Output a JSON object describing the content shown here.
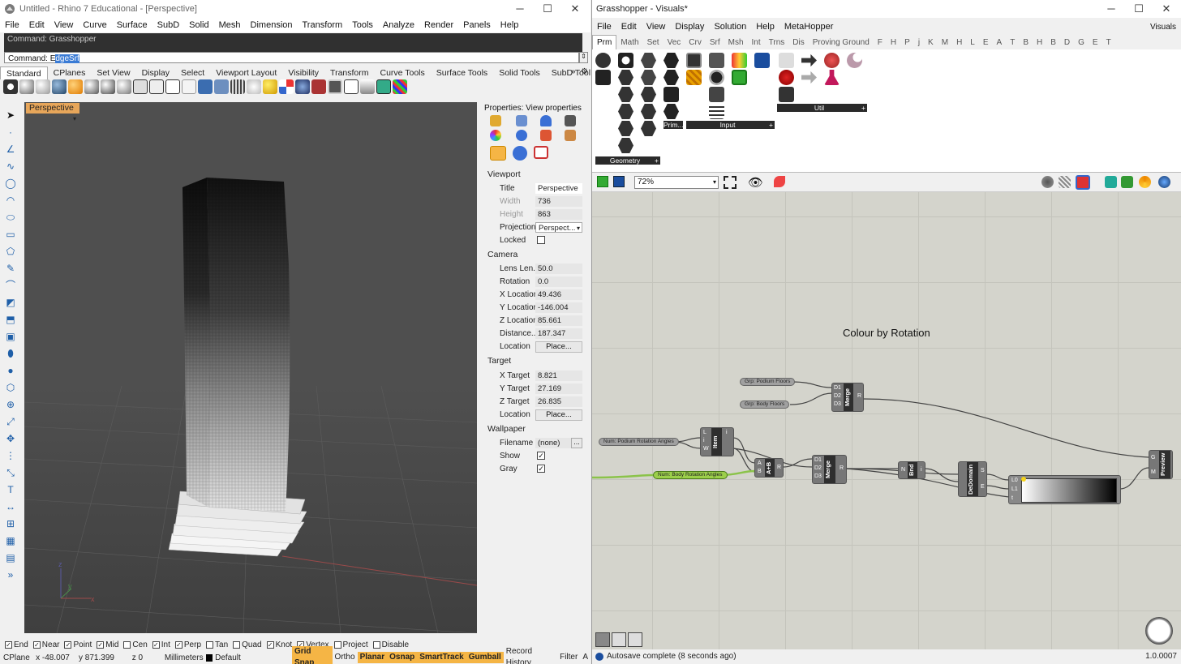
{
  "rhino": {
    "title": "Untitled - Rhino 7 Educational - [Perspective]",
    "menu": [
      "File",
      "Edit",
      "View",
      "Curve",
      "Surface",
      "SubD",
      "Solid",
      "Mesh",
      "Dimension",
      "Transform",
      "Tools",
      "Analyze",
      "Render",
      "Panels",
      "Help"
    ],
    "command_history": "Command: Grasshopper",
    "command_prefix": "Command: ",
    "command_first": "E",
    "command_selected": "dgeSrf",
    "tabs": [
      "Standard",
      "CPlanes",
      "Set View",
      "Display",
      "Select",
      "Viewport Layout",
      "Visibility",
      "Transform",
      "Curve Tools",
      "Surface Tools",
      "Solid Tools",
      "SubD Tools",
      "Mesh"
    ],
    "active_tab": "Standard",
    "viewport_label": "Perspective",
    "axis_labels": {
      "z": "z",
      "y": "y",
      "x": "x"
    },
    "properties": {
      "header": "Properties: View properties",
      "viewport_section": "Viewport",
      "title_label": "Title",
      "title_value": "Perspective",
      "width_label": "Width",
      "width_value": "736",
      "height_label": "Height",
      "height_value": "863",
      "projection_label": "Projection",
      "projection_value": "Perspect...",
      "locked_label": "Locked",
      "camera_section": "Camera",
      "lens_label": "Lens Len...",
      "lens_value": "50.0",
      "rotation_label": "Rotation",
      "rotation_value": "0.0",
      "xloc_label": "X Location",
      "xloc_value": "49.436",
      "yloc_label": "Y Location",
      "yloc_value": "-146.004",
      "zloc_label": "Z Location",
      "zloc_value": "85.661",
      "dist_label": "Distance...",
      "dist_value": "187.347",
      "location_label": "Location",
      "place_button": "Place...",
      "target_section": "Target",
      "xt_label": "X Target",
      "xt_value": "8.821",
      "yt_label": "Y Target",
      "yt_value": "27.169",
      "zt_label": "Z Target",
      "zt_value": "26.835",
      "location2_label": "Location",
      "wallpaper_section": "Wallpaper",
      "filename_label": "Filename",
      "filename_value": "(none)",
      "filename_btn": "...",
      "show_label": "Show",
      "gray_label": "Gray"
    },
    "snaps": [
      {
        "label": "End",
        "checked": true
      },
      {
        "label": "Near",
        "checked": true
      },
      {
        "label": "Point",
        "checked": true
      },
      {
        "label": "Mid",
        "checked": true
      },
      {
        "label": "Cen",
        "checked": false
      },
      {
        "label": "Int",
        "checked": true
      },
      {
        "label": "Perp",
        "checked": true
      },
      {
        "label": "Tan",
        "checked": false
      },
      {
        "label": "Quad",
        "checked": false
      },
      {
        "label": "Knot",
        "checked": true
      },
      {
        "label": "Vertex",
        "checked": true
      },
      {
        "label": "Project",
        "checked": false
      },
      {
        "label": "Disable",
        "checked": false
      }
    ],
    "status": {
      "cplane": "CPlane",
      "x": "x -48.007",
      "y": "y 871.399",
      "z": "z 0",
      "units": "Millimeters",
      "layer": "Default",
      "grid_snap": "Grid Snap",
      "ortho": "Ortho",
      "planar": "Planar",
      "osnap": "Osnap",
      "smarttrack": "SmartTrack",
      "gumball": "Gumball",
      "record": "Record History",
      "filter": "Filter",
      "filter_suffix": "A"
    }
  },
  "gh": {
    "title": "Grasshopper - Visuals*",
    "menu": [
      "File",
      "Edit",
      "View",
      "Display",
      "Solution",
      "Help",
      "MetaHopper"
    ],
    "doc_name": "Visuals",
    "tabs": [
      "Prm",
      "Math",
      "Set",
      "Vec",
      "Crv",
      "Srf",
      "Msh",
      "Int",
      "Trns",
      "Dis",
      "Proving Ground",
      "F",
      "H",
      "P",
      "j",
      "K",
      "M",
      "H",
      "L",
      "E",
      "A",
      "T",
      "B",
      "H",
      "B",
      "D",
      "G",
      "E",
      "T"
    ],
    "groups": {
      "geometry": "Geometry",
      "prim": "Prim...",
      "input": "Input",
      "util": "Util"
    },
    "zoom": "72%",
    "canvas_title": "Colour by Rotation",
    "params": {
      "podium_floors": "Grp: Podium Floors",
      "body_floors": "Grp: Body Floors",
      "podium_angles": "Num: Podium Rotation Angles",
      "body_angles": "Num: Body Rotation Angles"
    },
    "components": {
      "merge1": "Merge",
      "item": "Item",
      "add": "A+B",
      "merge2": "Merge",
      "bnd": "Bnd",
      "dedomain": "DeDomain",
      "preview": "Preview"
    },
    "ports": {
      "d1": "D1",
      "d2": "D2",
      "d3": "D3",
      "r": "R",
      "l": "L",
      "i": "i",
      "w": "W",
      "a": "A",
      "b": "B",
      "n": "N",
      "s": "S",
      "e": "E",
      "l0": "L0",
      "l1": "L1",
      "t": "t",
      "g": "G",
      "m": "M"
    },
    "status": "Autosave complete (8 seconds ago)",
    "version": "1.0.0007"
  }
}
